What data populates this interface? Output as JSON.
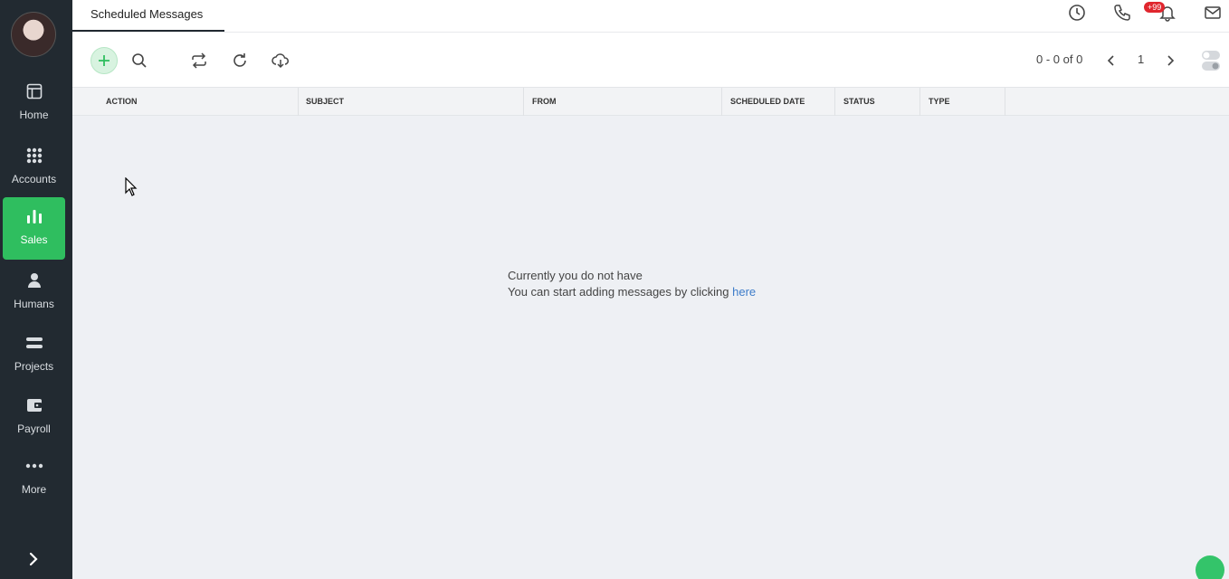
{
  "sidebar": {
    "items": [
      {
        "label": "Home",
        "icon": "home-icon"
      },
      {
        "label": "Accounts",
        "icon": "grid-icon"
      },
      {
        "label": "Sales",
        "icon": "bar-chart-icon"
      },
      {
        "label": "Humans",
        "icon": "person-icon"
      },
      {
        "label": "Projects",
        "icon": "projects-icon"
      },
      {
        "label": "Payroll",
        "icon": "wallet-icon"
      },
      {
        "label": "More",
        "icon": "more-icon"
      }
    ],
    "active": "Sales",
    "active_color": "#2fbe5f",
    "bg_color": "#222a31"
  },
  "header": {
    "tab_title": "Scheduled Messages",
    "notification_badge": "+99"
  },
  "toolbar": {
    "pager_text": "0 - 0 of 0",
    "page_number": "1"
  },
  "table": {
    "columns": [
      "ACTION",
      "SUBJECT",
      "FROM",
      "SCHEDULED DATE",
      "STATUS",
      "TYPE"
    ]
  },
  "empty_state": {
    "line1": "Currently you do not have",
    "line2_prefix": "You can start adding messages by clicking",
    "link_text": "here"
  }
}
